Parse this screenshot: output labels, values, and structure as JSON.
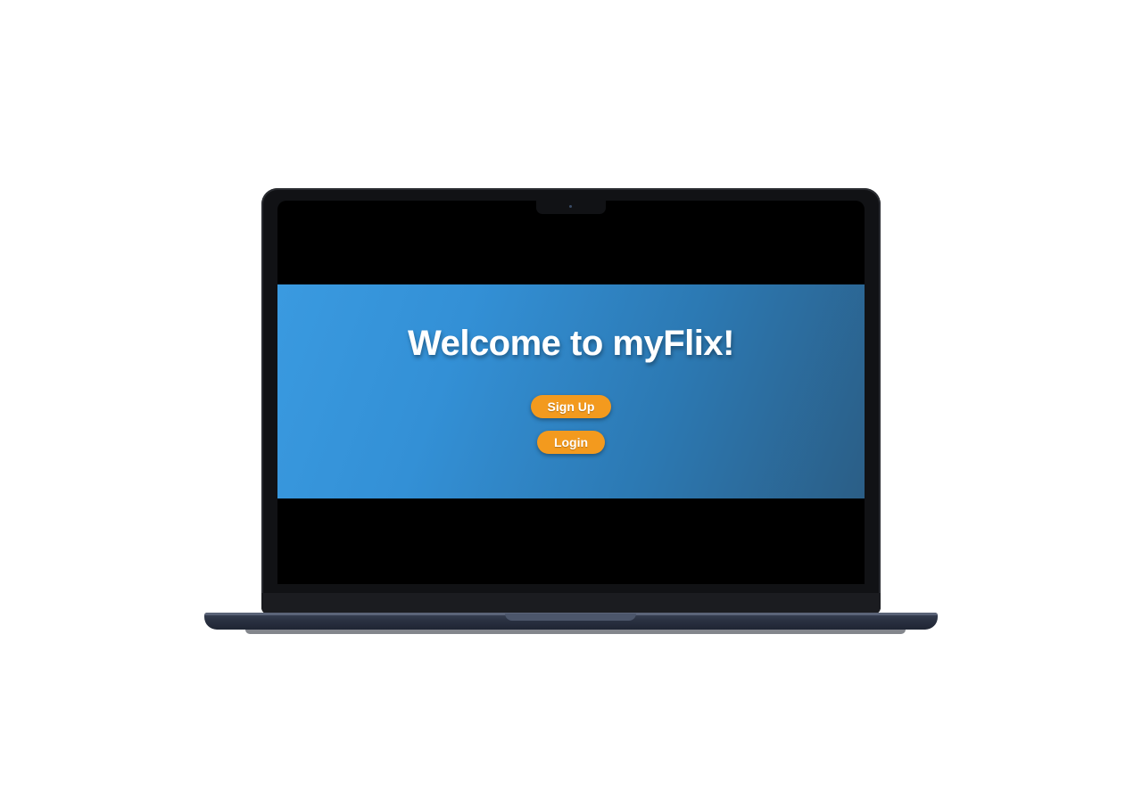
{
  "hero": {
    "title": "Welcome to myFlix!",
    "signup_label": "Sign Up",
    "login_label": "Login"
  },
  "colors": {
    "hero_gradient_start": "#3a9ae0",
    "hero_gradient_end": "#2b5e86",
    "button": "#f39a1e",
    "button_text": "#ffffff",
    "laptop_bezel": "#111215",
    "laptop_base": "#2a3142"
  }
}
